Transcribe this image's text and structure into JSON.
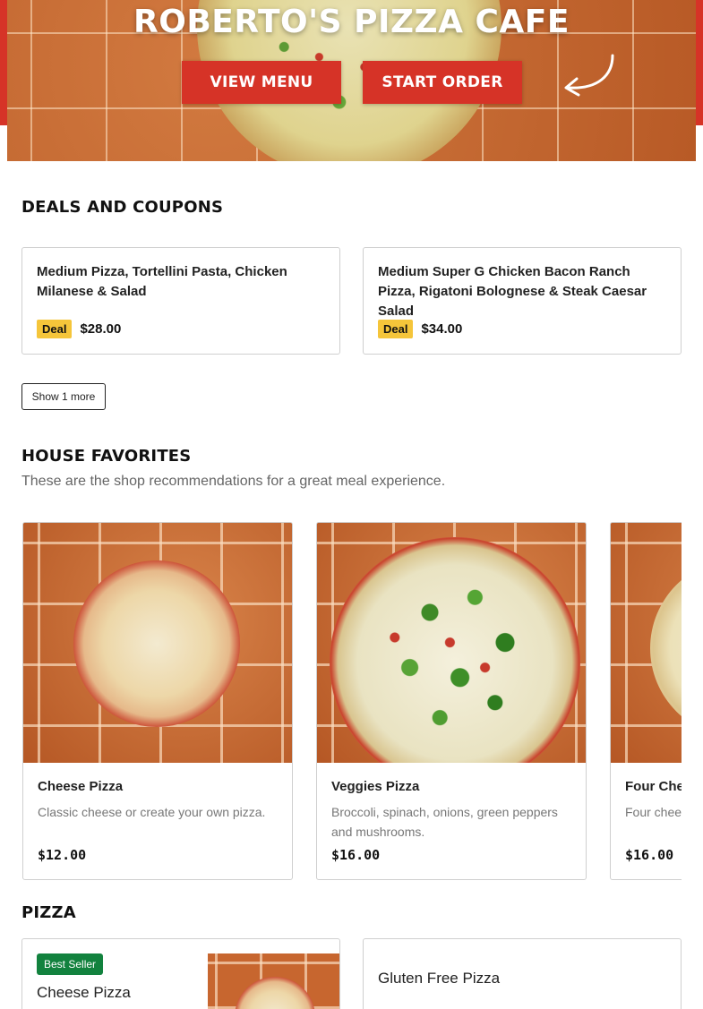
{
  "hero": {
    "title": "ROBERTO'S PIZZA CAFE",
    "view_menu_label": "VIEW MENU",
    "start_order_label": "START ORDER"
  },
  "deals": {
    "title": "DEALS AND COUPONS",
    "items": [
      {
        "name": "Medium Pizza, Tortellini Pasta, Chicken Milanese & Salad",
        "badge": "Deal",
        "price": "$28.00"
      },
      {
        "name": "Medium Super G Chicken Bacon Ranch Pizza, Rigatoni Bolognese & Steak Caesar Salad",
        "badge": "Deal",
        "price": "$34.00"
      }
    ],
    "show_more_label": "Show 1 more"
  },
  "favorites": {
    "title": "HOUSE FAVORITES",
    "subtitle": "These are the shop recommendations for a great meal experience.",
    "items": [
      {
        "name": "Cheese Pizza",
        "description": "Classic cheese or create your own pizza.",
        "price": "$12.00"
      },
      {
        "name": "Veggies Pizza",
        "description": "Broccoli, spinach, onions, green peppers and mushrooms.",
        "price": "$16.00"
      },
      {
        "name": "Four Cheese Pizza",
        "description": "Four cheese",
        "price": "$16.00"
      }
    ]
  },
  "pizza": {
    "title": "PIZZA",
    "items": [
      {
        "badge": "Best Seller",
        "name": "Cheese Pizza"
      },
      {
        "name": "Gluten Free Pizza"
      }
    ]
  },
  "colors": {
    "brand_red": "#d63327",
    "deal_badge": "#f5c53a",
    "best_seller_badge": "#12823e"
  },
  "icons": {
    "hero_arrow": "curved-arrow-icon"
  }
}
